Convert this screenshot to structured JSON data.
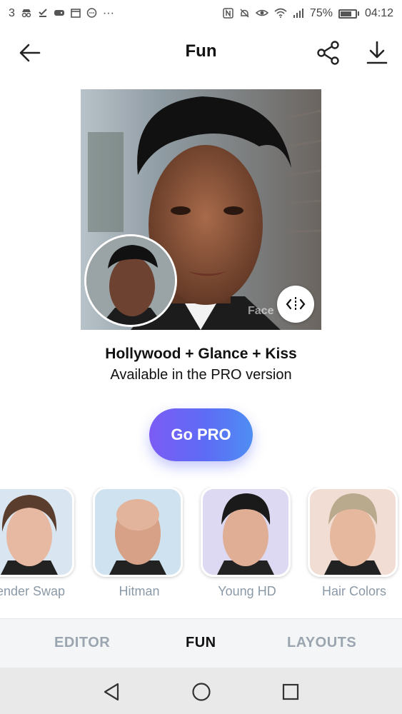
{
  "status_bar": {
    "notification_count": "3",
    "more_dots": "···",
    "battery_percent": "75%",
    "battery_level": 0.75,
    "time": "04:12",
    "icons": [
      "incognito-icon",
      "check-icon",
      "gamepad-icon",
      "calendar-icon",
      "chat-icon",
      "nfc-icon",
      "mute-icon",
      "eye-icon",
      "wifi-icon",
      "signal-icon",
      "battery-icon"
    ]
  },
  "header": {
    "title": "Fun",
    "icons": [
      "back-arrow-icon",
      "share-icon",
      "download-icon"
    ]
  },
  "photo": {
    "watermark": "Face"
  },
  "info": {
    "filter_name": "Hollywood + Glance + Kiss",
    "availability": "Available in the PRO version"
  },
  "cta": {
    "label": "Go PRO"
  },
  "filters": [
    {
      "label": "ender Swap"
    },
    {
      "label": "Hitman"
    },
    {
      "label": "Young HD"
    },
    {
      "label": "Hair Colors"
    }
  ],
  "tabs": [
    {
      "label": "EDITOR"
    },
    {
      "label": "FUN"
    },
    {
      "label": "LAYOUTS"
    }
  ],
  "active_tab": "FUN",
  "colors": {
    "cta_start": "#7b5cf5",
    "cta_end": "#4f8ef3",
    "tab_inactive": "#9aa5b0",
    "label_gray": "#8b99a6"
  }
}
